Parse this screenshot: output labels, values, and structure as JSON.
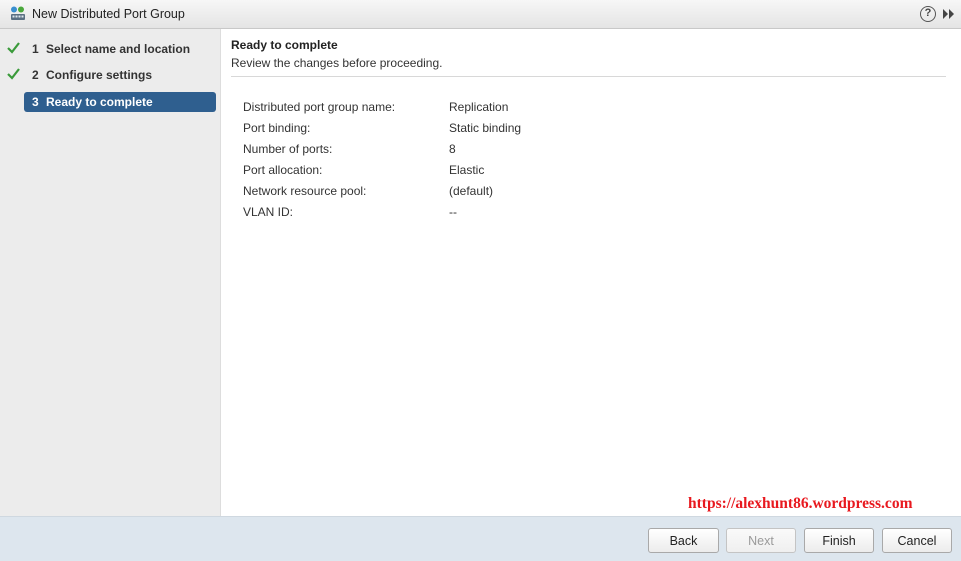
{
  "window": {
    "title": "New Distributed Port Group",
    "help_label": "?",
    "icon": "distributed-port-group-icon"
  },
  "steps": [
    {
      "number": "1",
      "label": "Select name and location",
      "completed": true
    },
    {
      "number": "2",
      "label": "Configure settings",
      "completed": true
    },
    {
      "number": "3",
      "label": "Ready to complete",
      "completed": false,
      "active": true
    }
  ],
  "content": {
    "title": "Ready to complete",
    "subtitle": "Review the changes before proceeding.",
    "summary": [
      {
        "key": "Distributed port group name:",
        "value": "Replication"
      },
      {
        "key": "Port binding:",
        "value": "Static binding"
      },
      {
        "key": "Number of ports:",
        "value": "8"
      },
      {
        "key": "Port allocation:",
        "value": "Elastic"
      },
      {
        "key": "Network resource pool:",
        "value": "(default)"
      },
      {
        "key": "VLAN ID:",
        "value": "--"
      }
    ]
  },
  "watermark": "https://alexhunt86.wordpress.com",
  "buttons": {
    "back": "Back",
    "next": "Next",
    "finish": "Finish",
    "cancel": "Cancel"
  },
  "colors": {
    "active_step": "#2f5f8f",
    "check": "#3a9a3a",
    "watermark": "#e8191f",
    "footer": "#dde6ee"
  }
}
